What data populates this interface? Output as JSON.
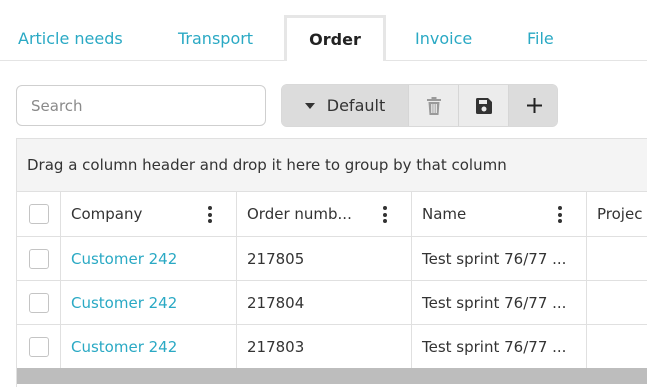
{
  "tabs": [
    {
      "label": "Article needs",
      "active": false
    },
    {
      "label": "Transport",
      "active": false
    },
    {
      "label": "Order",
      "active": true
    },
    {
      "label": "Invoice",
      "active": false
    },
    {
      "label": "File",
      "active": false
    }
  ],
  "toolbar": {
    "search_placeholder": "Search",
    "view_label": "Default",
    "icons": {
      "caret": "caret-down-icon",
      "delete": "trash-icon",
      "save": "floppy-disk-icon",
      "add": "plus-icon"
    }
  },
  "grid": {
    "group_panel_text": "Drag a column header and drop it here to group by that column",
    "columns": [
      "Company",
      "Order numb...",
      "Name",
      "Projec"
    ],
    "rows": [
      {
        "company": "Customer 242",
        "order_number": "217805",
        "name": "Test sprint 76/77 ...",
        "project": ""
      },
      {
        "company": "Customer 242",
        "order_number": "217804",
        "name": "Test sprint 76/77 ...",
        "project": ""
      },
      {
        "company": "Customer 242",
        "order_number": "217803",
        "name": "Test sprint 76/77 ...",
        "project": ""
      }
    ]
  },
  "colors": {
    "accent": "#2aa9c4",
    "text": "#333333",
    "border": "#e0e0e0"
  }
}
